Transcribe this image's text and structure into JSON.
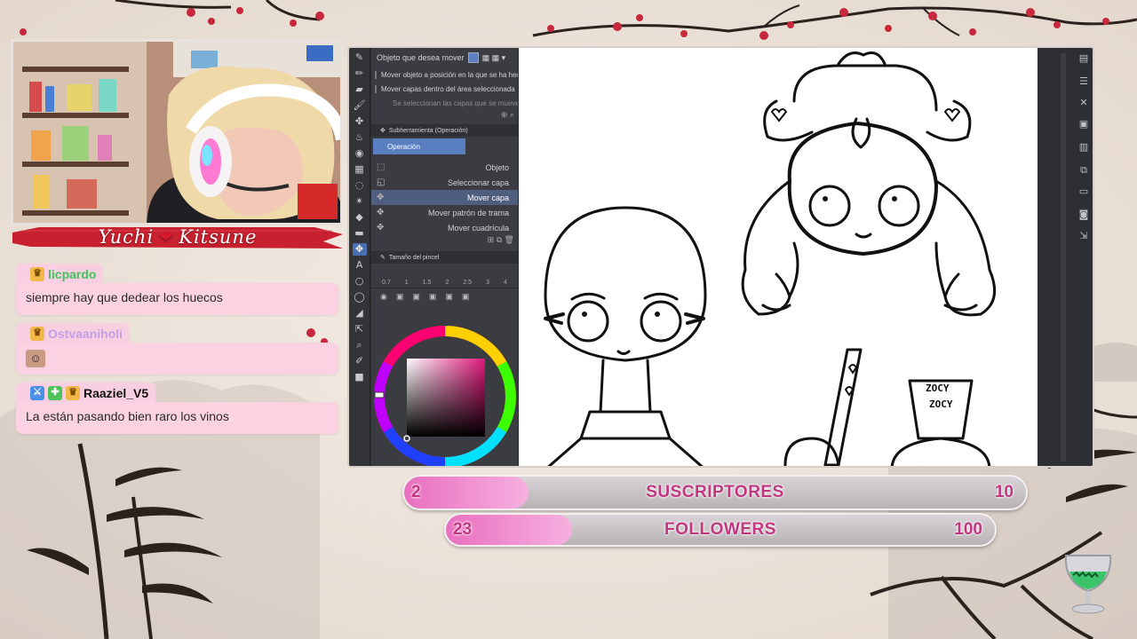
{
  "streamer": {
    "name_left": "Yuchi",
    "name_right": "Kitsune"
  },
  "chat": [
    {
      "user": "licpardo",
      "user_color": "#3ec25b",
      "badges": [
        "crown"
      ],
      "text": "siempre hay que dedear los huecos",
      "emote": ""
    },
    {
      "user": "Ostvaaniholi",
      "user_color": "#c49ee6",
      "badges": [
        "crown"
      ],
      "text": "",
      "emote": "face-emote"
    },
    {
      "user": "Raaziel_V5",
      "user_color": "#111111",
      "badges": [
        "sword",
        "plus",
        "crown"
      ],
      "text": "La están pasando bien raro los vinos",
      "emote": ""
    }
  ],
  "app": {
    "move_target_label": "Objeto que desea mover",
    "option1": "Mover objeto a posición en la que se ha hecho clic",
    "option2": "Mover capas dentro del área seleccionada",
    "option3": "Se seleccionan las capas que se mueven",
    "subtool_header": "Subherramienta (Operación)",
    "operation_tab": "Operación",
    "subtools": [
      {
        "label": "Objeto",
        "active": false
      },
      {
        "label": "Seleccionar capa",
        "active": false
      },
      {
        "label": "Mover capa",
        "active": true
      },
      {
        "label": "Mover patrón de trama",
        "active": false
      },
      {
        "label": "Mover cuadrícula",
        "active": false
      }
    ],
    "brush_header": "Tamaño del pincel",
    "brush_sizes": [
      "0.7",
      "1",
      "1.5",
      "2",
      "2.5",
      "3",
      "4"
    ],
    "accent": "#5a7fc0"
  },
  "goals": [
    {
      "title": "SUSCRIPTORES",
      "current": "2",
      "max": "10",
      "progress": 0.2
    },
    {
      "title": "FOLLOWERS",
      "current": "23",
      "max": "100",
      "progress": 0.23
    }
  ],
  "colors": {
    "pink": "#fbd2e1",
    "banner_red": "#c8202e",
    "goal_text": "#c0367f"
  }
}
